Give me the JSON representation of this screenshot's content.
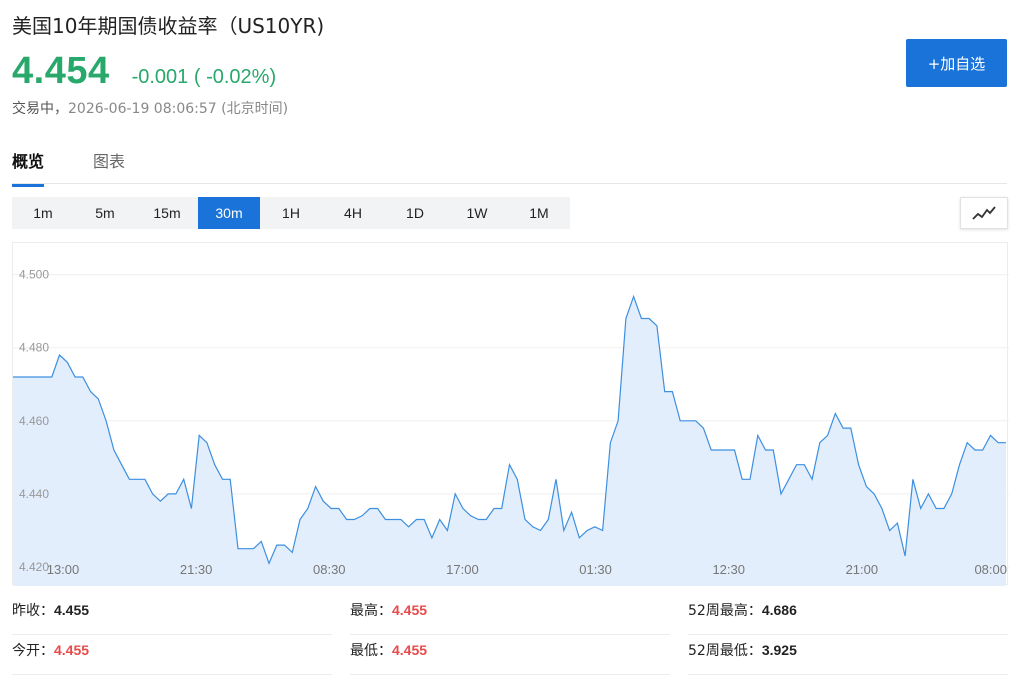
{
  "header": {
    "title": "美国10年期国债收益率（US10YR)",
    "price": "4.454",
    "change": "-0.001 ( -0.02%)",
    "status": "交易中，",
    "timestamp": "2026-06-19 08:06:57",
    "timezone": "(北京时间)",
    "add_button": "+加自选"
  },
  "tabs": [
    {
      "label": "概览",
      "active": true
    },
    {
      "label": "图表",
      "active": false
    }
  ],
  "intervals": [
    "1m",
    "5m",
    "15m",
    "30m",
    "1H",
    "4H",
    "1D",
    "1W",
    "1M"
  ],
  "active_interval": "30m",
  "chart_type_icon": "line-chart-icon",
  "colors": {
    "accent": "#1a73d9",
    "up_green": "#28a86b",
    "down_red": "#e84a4a",
    "line": "#3d8fe0",
    "fill": "#e2eefc"
  },
  "chart_data": {
    "type": "area",
    "ylim": [
      4.42,
      4.504
    ],
    "y_ticks": [
      "4.500",
      "4.480",
      "4.460",
      "4.440",
      "4.420"
    ],
    "x_ticks": [
      "13:00",
      "21:30",
      "08:30",
      "17:00",
      "01:30",
      "12:30",
      "21:00",
      "08:00"
    ],
    "values": [
      4.472,
      4.472,
      4.472,
      4.472,
      4.472,
      4.472,
      4.478,
      4.476,
      4.472,
      4.472,
      4.468,
      4.466,
      4.46,
      4.452,
      4.448,
      4.444,
      4.444,
      4.444,
      4.44,
      4.438,
      4.44,
      4.44,
      4.444,
      4.436,
      4.456,
      4.454,
      4.448,
      4.444,
      4.444,
      4.425,
      4.425,
      4.425,
      4.427,
      4.421,
      4.426,
      4.426,
      4.424,
      4.433,
      4.436,
      4.442,
      4.438,
      4.436,
      4.436,
      4.433,
      4.433,
      4.434,
      4.436,
      4.436,
      4.433,
      4.433,
      4.433,
      4.431,
      4.433,
      4.433,
      4.428,
      4.433,
      4.43,
      4.44,
      4.436,
      4.434,
      4.433,
      4.433,
      4.436,
      4.436,
      4.448,
      4.444,
      4.433,
      4.431,
      4.43,
      4.433,
      4.444,
      4.43,
      4.435,
      4.428,
      4.43,
      4.431,
      4.43,
      4.454,
      4.46,
      4.488,
      4.494,
      4.488,
      4.488,
      4.486,
      4.468,
      4.468,
      4.46,
      4.46,
      4.46,
      4.458,
      4.452,
      4.452,
      4.452,
      4.452,
      4.444,
      4.444,
      4.456,
      4.452,
      4.452,
      4.44,
      4.444,
      4.448,
      4.448,
      4.444,
      4.454,
      4.456,
      4.462,
      4.458,
      4.458,
      4.448,
      4.442,
      4.44,
      4.436,
      4.43,
      4.432,
      4.423,
      4.444,
      4.436,
      4.44,
      4.436,
      4.436,
      4.44,
      4.448,
      4.454,
      4.452,
      4.452,
      4.456,
      4.454,
      4.454
    ]
  },
  "stats": [
    {
      "label": "昨收：",
      "value": "4.455",
      "color": "black"
    },
    {
      "label": "最高：",
      "value": "4.455",
      "color": "red"
    },
    {
      "label": "52周最高：",
      "value": "4.686",
      "color": "black"
    },
    {
      "label": "今开：",
      "value": "4.455",
      "color": "red"
    },
    {
      "label": "最低：",
      "value": "4.455",
      "color": "red"
    },
    {
      "label": "52周最低：",
      "value": "3.925",
      "color": "black"
    }
  ]
}
